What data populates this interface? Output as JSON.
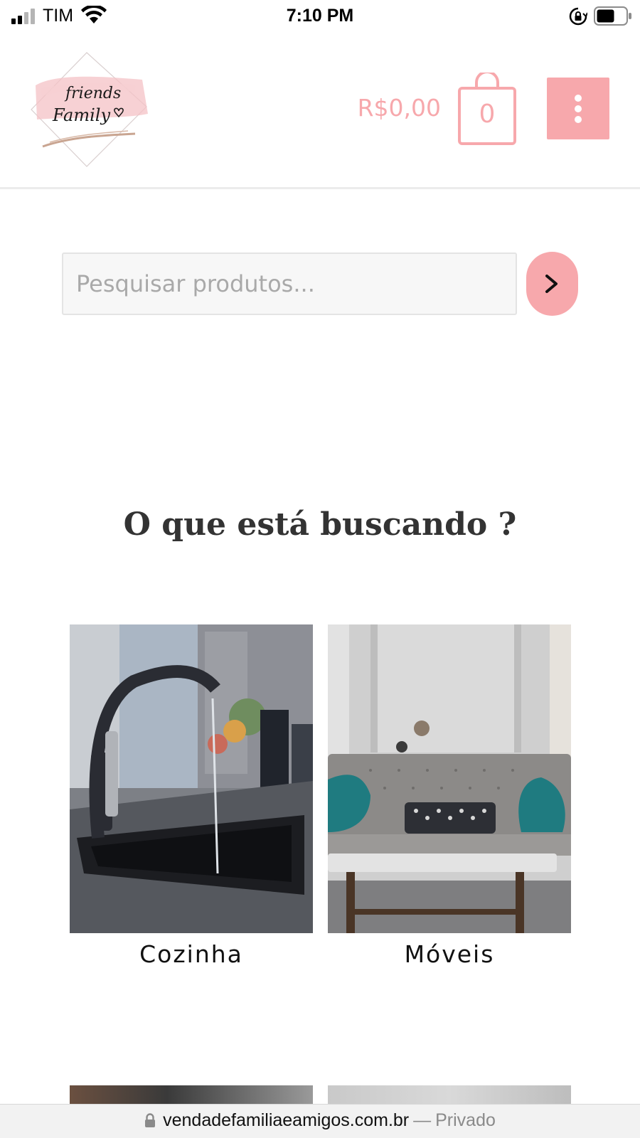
{
  "status_bar": {
    "carrier": "TIM",
    "time": "7:10 PM"
  },
  "header": {
    "logo_text_line1": "friends",
    "logo_text_line2": "Family",
    "cart_total": "R$0,00",
    "cart_count": "0"
  },
  "search": {
    "placeholder": "Pesquisar produtos...",
    "value": ""
  },
  "section": {
    "title": "O que está buscando ?"
  },
  "categories": [
    {
      "label": "Cozinha"
    },
    {
      "label": "Móveis"
    }
  ],
  "url_bar": {
    "domain": "vendadefamiliaeamigos.com.br",
    "separator": "—",
    "mode": "Privado"
  },
  "colors": {
    "accent": "#f7a8ac",
    "text_dark": "#333333"
  }
}
